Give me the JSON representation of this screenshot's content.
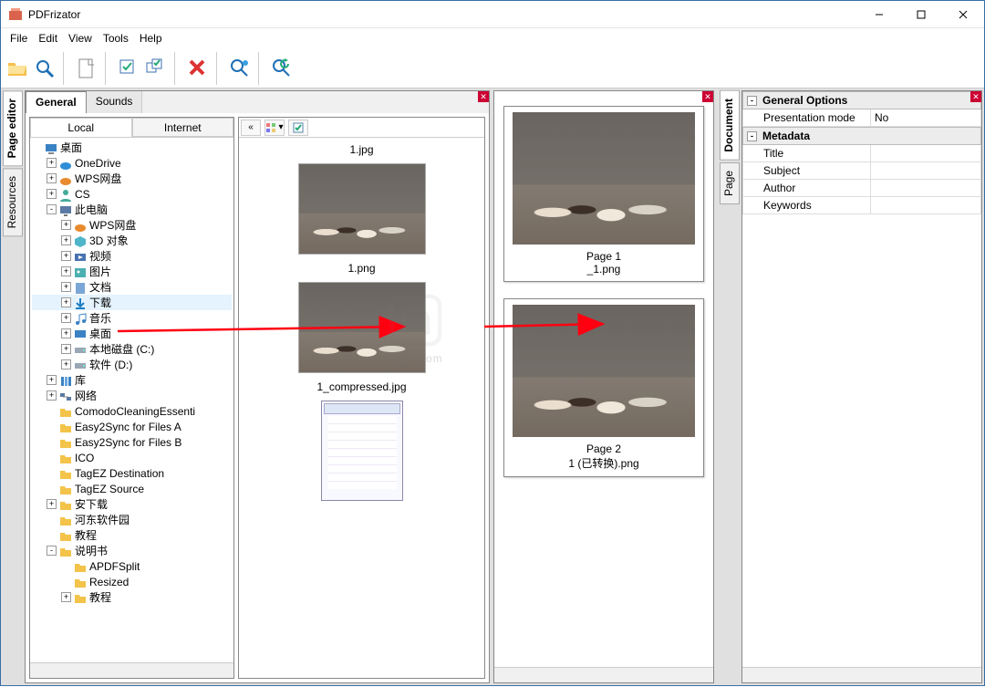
{
  "app_title": "PDFrizator",
  "menu": {
    "file": "File",
    "edit": "Edit",
    "view": "View",
    "tools": "Tools",
    "help": "Help"
  },
  "tabs": {
    "general": "General",
    "sounds": "Sounds"
  },
  "subtabs": {
    "local": "Local",
    "internet": "Internet"
  },
  "vtabs": {
    "page_editor": "Page editor",
    "resources": "Resources",
    "document": "Document",
    "page": "Page"
  },
  "tree": [
    {
      "ind": 0,
      "exp": "",
      "label": "桌面",
      "icon": "desktop"
    },
    {
      "ind": 1,
      "exp": "+",
      "label": "OneDrive",
      "icon": "cloud-blue"
    },
    {
      "ind": 1,
      "exp": "+",
      "label": "WPS网盘",
      "icon": "cloud-orange"
    },
    {
      "ind": 1,
      "exp": "+",
      "label": "CS",
      "icon": "user"
    },
    {
      "ind": 1,
      "exp": "-",
      "label": "此电脑",
      "icon": "pc"
    },
    {
      "ind": 2,
      "exp": "+",
      "label": "WPS网盘",
      "icon": "cloud-orange"
    },
    {
      "ind": 2,
      "exp": "+",
      "label": "3D 对象",
      "icon": "3d"
    },
    {
      "ind": 2,
      "exp": "+",
      "label": "视频",
      "icon": "video"
    },
    {
      "ind": 2,
      "exp": "+",
      "label": "图片",
      "icon": "pic"
    },
    {
      "ind": 2,
      "exp": "+",
      "label": "文档",
      "icon": "doc"
    },
    {
      "ind": 2,
      "exp": "+",
      "label": "下载",
      "icon": "download",
      "sel": true
    },
    {
      "ind": 2,
      "exp": "+",
      "label": "音乐",
      "icon": "music"
    },
    {
      "ind": 2,
      "exp": "+",
      "label": "桌面",
      "icon": "desk2"
    },
    {
      "ind": 2,
      "exp": "+",
      "label": "本地磁盘 (C:)",
      "icon": "disk"
    },
    {
      "ind": 2,
      "exp": "+",
      "label": "软件 (D:)",
      "icon": "disk"
    },
    {
      "ind": 1,
      "exp": "+",
      "label": "库",
      "icon": "lib"
    },
    {
      "ind": 1,
      "exp": "+",
      "label": "网络",
      "icon": "net"
    },
    {
      "ind": 1,
      "exp": "",
      "label": "ComodoCleaningEssenti",
      "icon": "fold"
    },
    {
      "ind": 1,
      "exp": "",
      "label": "Easy2Sync for Files A",
      "icon": "fold"
    },
    {
      "ind": 1,
      "exp": "",
      "label": "Easy2Sync for Files B",
      "icon": "fold"
    },
    {
      "ind": 1,
      "exp": "",
      "label": "ICO",
      "icon": "fold"
    },
    {
      "ind": 1,
      "exp": "",
      "label": "TagEZ Destination",
      "icon": "fold"
    },
    {
      "ind": 1,
      "exp": "",
      "label": "TagEZ Source",
      "icon": "fold"
    },
    {
      "ind": 1,
      "exp": "+",
      "label": "安下载",
      "icon": "fold"
    },
    {
      "ind": 1,
      "exp": "",
      "label": "河东软件园",
      "icon": "fold"
    },
    {
      "ind": 1,
      "exp": "",
      "label": "教程",
      "icon": "fold"
    },
    {
      "ind": 1,
      "exp": "-",
      "label": "说明书",
      "icon": "fold"
    },
    {
      "ind": 2,
      "exp": "",
      "label": "APDFSplit",
      "icon": "fold"
    },
    {
      "ind": 2,
      "exp": "",
      "label": "Resized",
      "icon": "fold"
    },
    {
      "ind": 2,
      "exp": "+",
      "label": "教程",
      "icon": "fold"
    }
  ],
  "thumbs": {
    "f1": "1.jpg",
    "f2": "1.png",
    "f3": "1_compressed.jpg"
  },
  "pages": {
    "p1_label": "Page 1",
    "p1_file": "_1.png",
    "p2_label": "Page 2",
    "p2_file": "1 (已转换).png"
  },
  "props": {
    "sec1": "General Options",
    "presentation_k": "Presentation mode",
    "presentation_v": "No",
    "sec2": "Metadata",
    "title_k": "Title",
    "subject_k": "Subject",
    "author_k": "Author",
    "keywords_k": "Keywords"
  },
  "watermark_text": "anxz.com"
}
